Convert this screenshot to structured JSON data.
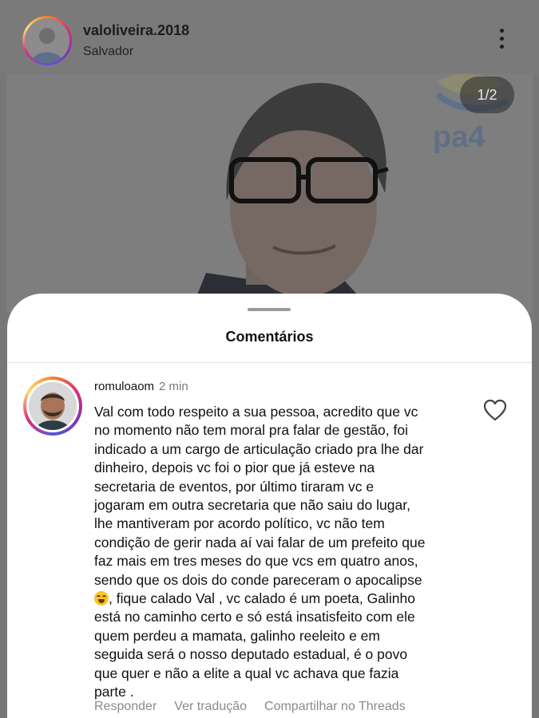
{
  "post": {
    "username": "valoliveira.2018",
    "location": "Salvador",
    "image_counter": "1/2",
    "image_logo_text": "pa4",
    "more_icon": "more-vertical-icon",
    "header_avatar_icon": "profile-photo"
  },
  "comments_sheet": {
    "title": "Comentários",
    "comment": {
      "username": "romuloaom",
      "time": "2 min",
      "text_before_emoji": "Val com todo respeito a sua pessoa, acredito que vc\nno momento não tem moral pra falar de gestão, foi\nindicado a um cargo de articulação criado pra lhe dar\ndinheiro,  depois vc foi o pior que já esteve na\nsecretaria de eventos,  por último tiraram vc e\njogaram em outra secretaria que não saiu do lugar,\nlhe mantiveram por acordo político, vc não tem\ncondição de gerir nada aí vai falar de um prefeito que\nfaz mais em tres meses do que vcs em quatro anos,\nsendo que os dois do conde pareceram o apocalipse\n",
      "emoji": "face-with-tears-of-joy",
      "text_after_emoji": ", fique calado Val , vc calado é um poeta, Galinho\nestá no caminho certo e só está insatisfeito com ele\nquem perdeu a mamata,  galinho reeleito e em\nseguida será o nosso deputado estadual, é o povo\nque quer e não a elite a qual vc achava que fazia\nparte .",
      "actions": {
        "reply": "Responder",
        "translate": "Ver tradução",
        "share": "Compartilhar no Threads"
      },
      "like_icon": "heart-outline-icon"
    }
  },
  "colors": {
    "overlay_bg": "#777777",
    "sheet_bg": "#ffffff",
    "secondary_text": "#8a8a8a"
  }
}
